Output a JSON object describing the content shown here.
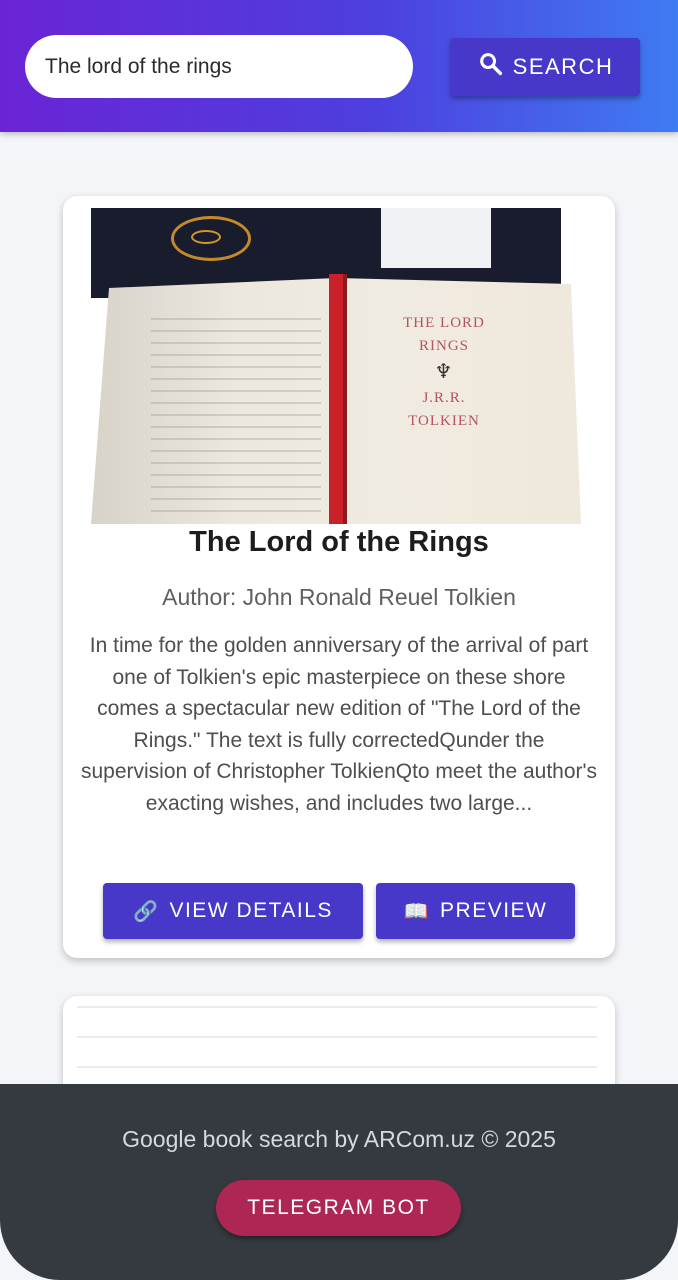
{
  "search": {
    "value": "The lord of the rings",
    "button_label": "SEARCH",
    "icon": "search-icon"
  },
  "results": [
    {
      "title": "The Lord of the Rings",
      "author": "Author: John Ronald Reuel Tolkien",
      "description": "In time for the golden anniversary of the arrival of part one of Tolkien's epic masterpiece on these shore comes a spectacular new edition of \"The Lord of the Rings.\" The text is fully correctedQunder the supervision of Christopher TolkienQto meet the author's exacting wishes, and includes two large...",
      "view_details_icon": "🔗",
      "view_details_label": "VIEW DETAILS",
      "preview_icon": "📖",
      "preview_label": "PREVIEW"
    }
  ],
  "footer": {
    "text": "Google book search by ARCom.uz © 2025",
    "telegram_label": "TELEGRAM BOT"
  },
  "colors": {
    "header_gradient_start": "#6a24d6",
    "header_gradient_end": "#3f7bf2",
    "primary_button": "#4838c9",
    "footer_bg": "#343a40",
    "telegram_button": "#ae2653"
  }
}
